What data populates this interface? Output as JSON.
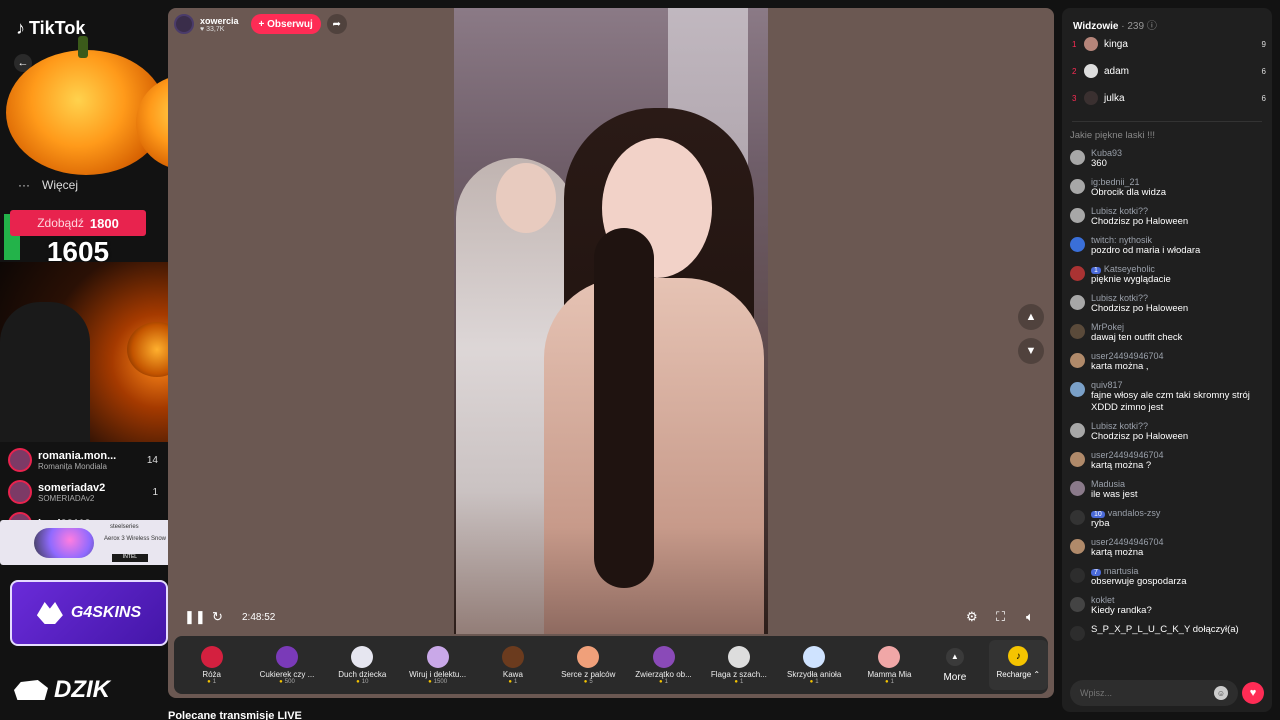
{
  "sidebar": {
    "logo": "TikTok",
    "more_label": "Więcej",
    "score_label": "Zdobądź",
    "score_target": "1800",
    "score_value": "1605",
    "ranking": [
      {
        "name": "romania.mon...",
        "sub": "Romanița Mondiala",
        "count": "14"
      },
      {
        "name": "someriadav2",
        "sub": "SOMERIADAv2",
        "count": "1"
      },
      {
        "name": "kopi22113",
        "sub": "",
        "count": ""
      }
    ],
    "ad_brand": "steelseries",
    "ad_product": "Aerox 3 Wireless Snow",
    "ad_tag": "INTEL",
    "g4_label": "G4SKINS",
    "dzik_label": "DZIK",
    "partial_user": "Karolinka"
  },
  "host": {
    "name": "xowercia",
    "likes": "33,7K",
    "follow_label": "+ Obserwuj"
  },
  "player": {
    "time": "2:48:52"
  },
  "gifts": [
    {
      "name": "Róża",
      "price": "1",
      "color": "#d4203f"
    },
    {
      "name": "Cukierek czy ...",
      "price": "500",
      "color": "#7a3ab8"
    },
    {
      "name": "Duch dziecka",
      "price": "10",
      "color": "#e6e6f0"
    },
    {
      "name": "Wiruj i delektu...",
      "price": "1500",
      "color": "#c9a8e8"
    },
    {
      "name": "Kawa",
      "price": "1",
      "color": "#6b3b1e"
    },
    {
      "name": "Serce z palców",
      "price": "5",
      "color": "#f0a07a"
    },
    {
      "name": "Zwierzątko ob...",
      "price": "1",
      "color": "#8a4ab8"
    },
    {
      "name": "Flaga z szach...",
      "price": "1",
      "color": "#dddddd"
    },
    {
      "name": "Skrzydła anioła",
      "price": "1",
      "color": "#cfe3ff"
    },
    {
      "name": "Mamma Mia",
      "price": "1",
      "color": "#f0a7a7"
    }
  ],
  "gifts_more": "More",
  "recharge_label": "Recharge",
  "recommended_title": "Polecane transmisje LIVE",
  "chat": {
    "viewers_label": "Widzowie",
    "viewers_count": "239",
    "top_viewers": [
      {
        "rank": "1",
        "name": "kinga",
        "count": "9"
      },
      {
        "rank": "2",
        "name": "adam",
        "count": "6"
      },
      {
        "rank": "3",
        "name": "julka",
        "count": "6"
      }
    ],
    "messages": [
      {
        "user": "",
        "text": "Jakie piękne laski !!!"
      },
      {
        "user": "Kuba93",
        "text": "360"
      },
      {
        "user": "ig:bednii_21",
        "text": "Obrocik dla widza"
      },
      {
        "user": "Lubisz kotki??",
        "text": "Chodzisz po Haloween"
      },
      {
        "user": "twitch: nythosik",
        "text": "pozdro od maria i włodara"
      },
      {
        "user": "Katseyeholic",
        "badge": "1",
        "text": "pięknie wyglądacie"
      },
      {
        "user": "Lubisz kotki??",
        "text": "Chodzisz po Haloween"
      },
      {
        "user": "MrPokej",
        "text": "dawaj ten outfit check"
      },
      {
        "user": "user24494946704",
        "text": "karta można ,"
      },
      {
        "user": "quiv817",
        "text": "fajne włosy ale czm taki skromny strój XDDD zimno jest"
      },
      {
        "user": "Lubisz kotki??",
        "text": "Chodzisz po Haloween"
      },
      {
        "user": "user24494946704",
        "text": "kartą można ?"
      },
      {
        "user": "Madusia",
        "text": "ile was jest"
      },
      {
        "user": "vandalos-zsy",
        "badge": "10",
        "text": "ryba"
      },
      {
        "user": "user24494946704",
        "text": "kartą można"
      },
      {
        "user": "martusia",
        "badge": "7",
        "text": "obserwuje gospodarza"
      },
      {
        "user": "koklet",
        "text": "Kiedy randka?"
      },
      {
        "user": "S_P_X_P_L_U_C_K_Y",
        "text": "dołączył(a)"
      }
    ],
    "input_placeholder": "Wpisz..."
  }
}
